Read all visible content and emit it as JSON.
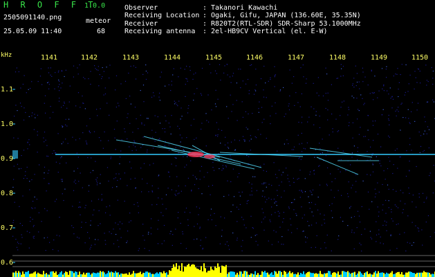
{
  "header": {
    "app_title": "H R O F F T",
    "app_version": "1.0.0",
    "file_name": "2505091140.png",
    "mode_label": "meteor",
    "timestamp": "25.05.09 11:40",
    "count": "68",
    "info": [
      {
        "key": "Observer",
        "value": "Takanori Kawachi"
      },
      {
        "key": "Receiving Location",
        "value": "Ogaki, Gifu, JAPAN (136.60E, 35.35N)"
      },
      {
        "key": "Receiver",
        "value": "R820T2(RTL-SDR) SDR-Sharp 53.1000MHz"
      },
      {
        "key": "Receiving antenna",
        "value": "2el-HB9CV Vertical (el. E-W)"
      }
    ]
  },
  "axes": {
    "unit_label": "kHz",
    "freq_ticks": [
      "1141",
      "1142",
      "1143",
      "1144",
      "1145",
      "1146",
      "1147",
      "1148",
      "1149",
      "1150"
    ],
    "y_ticks": [
      "1.1",
      "1.0",
      "0.9",
      "0.8",
      "0.7",
      "0.6"
    ]
  },
  "colors": {
    "background": "#000000",
    "noise": "#1a1a8c",
    "carrier": "#33ccff",
    "meteor_hot": "#ff3355",
    "signal_bar": "#ffff00",
    "noise_bar": "#00ccff"
  }
}
